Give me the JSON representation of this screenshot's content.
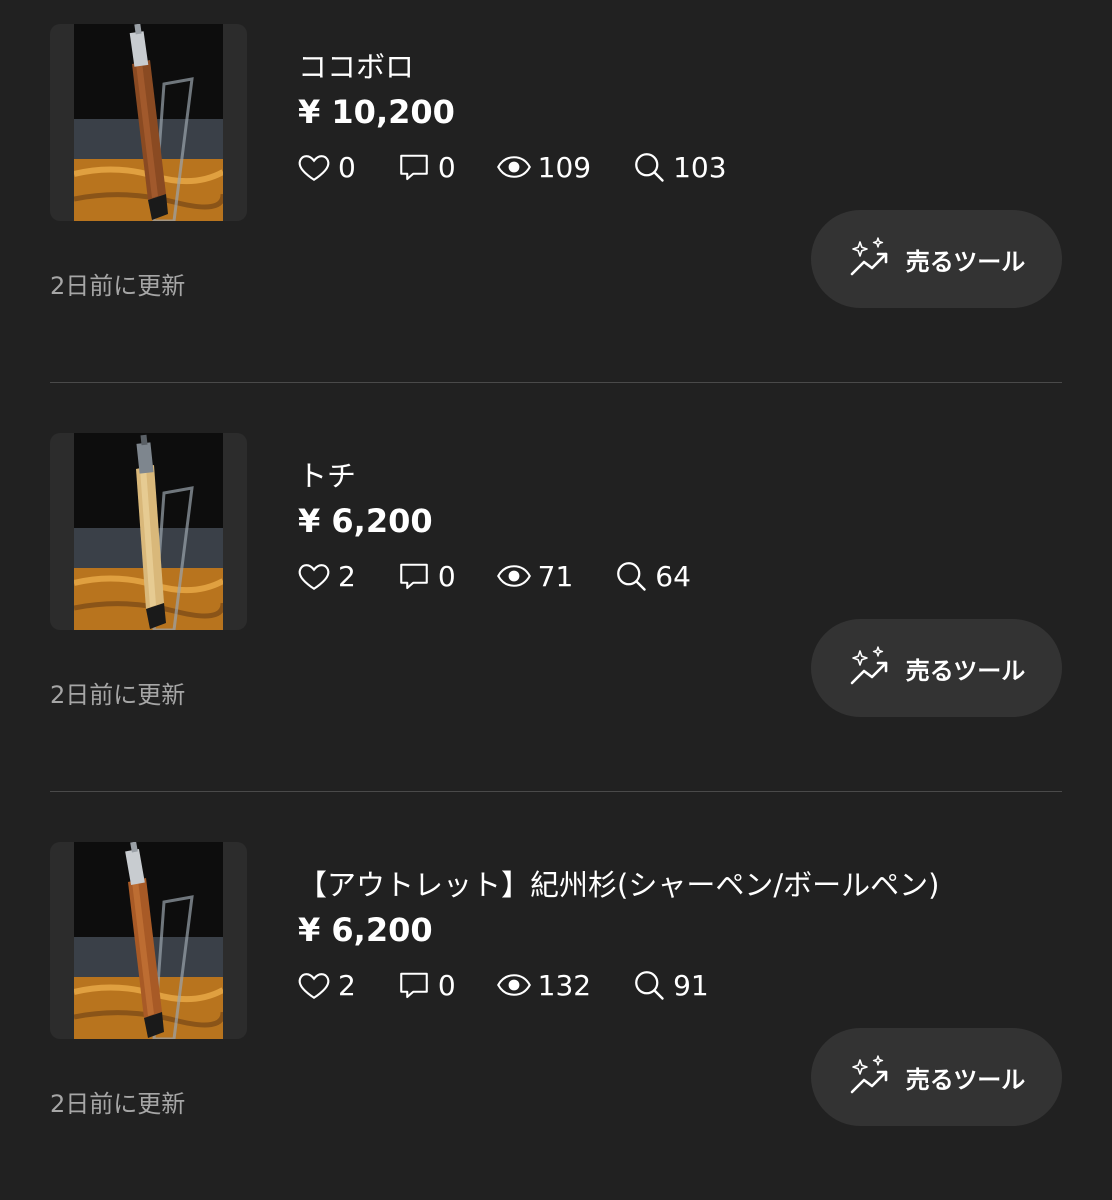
{
  "colors": {
    "background": "#212121",
    "button_bg": "#333333",
    "muted_text": "#a6a6a6",
    "divider": "#4a4a4a"
  },
  "items": [
    {
      "title": "ココボロ",
      "price": "¥ 10,200",
      "likes": "0",
      "comments": "0",
      "views": "109",
      "searches": "103",
      "updated": "2日前に更新",
      "tool_label": "売るツール",
      "wood_color": "#8a4a22"
    },
    {
      "title": "トチ",
      "price": "¥ 6,200",
      "likes": "2",
      "comments": "0",
      "views": "71",
      "searches": "64",
      "updated": "2日前に更新",
      "tool_label": "売るツール",
      "wood_color": "#d9b87a"
    },
    {
      "title": "【アウトレット】紀州杉(シャーペン/ボールペン)",
      "price": "¥ 6,200",
      "likes": "2",
      "comments": "0",
      "views": "132",
      "searches": "91",
      "updated": "2日前に更新",
      "tool_label": "売るツール",
      "wood_color": "#a85a26"
    }
  ]
}
